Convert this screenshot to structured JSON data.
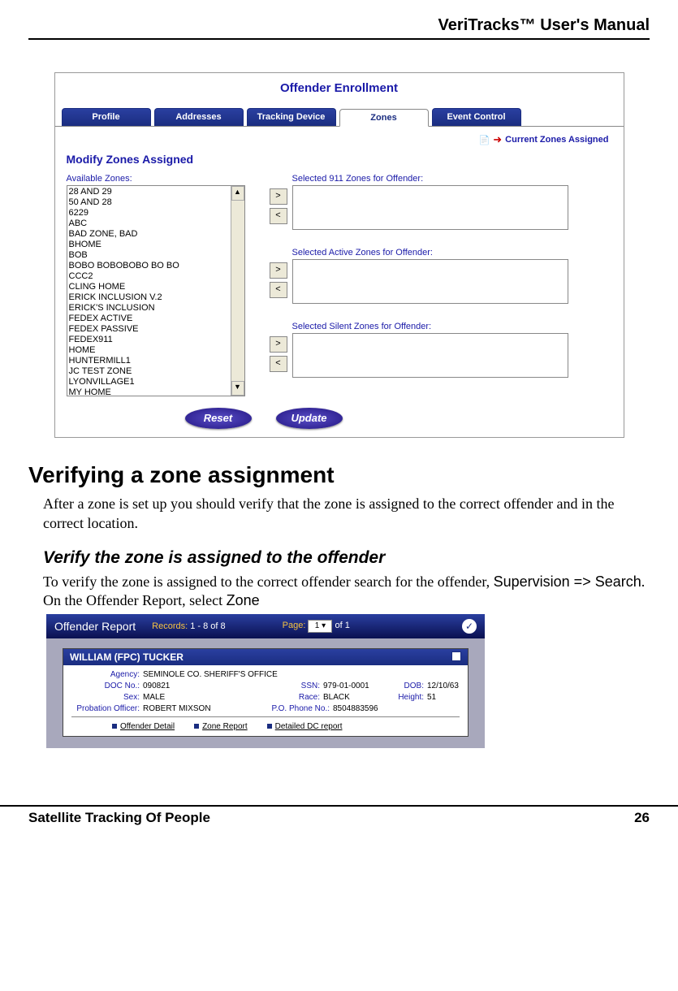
{
  "header": {
    "title": "VeriTracks™ User's Manual"
  },
  "screenshot1": {
    "title": "Offender Enrollment",
    "tabs": [
      "Profile",
      "Addresses",
      "Tracking Device",
      "Zones",
      "Event Control"
    ],
    "current_link": "Current Zones Assigned",
    "section_title": "Modify Zones Assigned",
    "available_label": "Available Zones:",
    "available_items": [
      "28 AND 29",
      "50 AND 28",
      "6229",
      "ABC",
      "BAD ZONE, BAD",
      "BHOME",
      "BOB",
      "BOBO BOBOBOBO BO BO",
      "CCC2",
      "CLING HOME",
      "ERICK INCLUSION V.2",
      "ERICK'S INCLUSION",
      "FEDEX ACTIVE",
      "FEDEX PASSIVE",
      "FEDEX911",
      "HOME",
      "HUNTERMILL1",
      "JC TEST ZONE",
      "LYONVILLAGE1",
      "MY HOME"
    ],
    "sel_911": "Selected 911 Zones for Offender:",
    "sel_active": "Selected Active Zones for Offender:",
    "sel_silent": "Selected Silent Zones for Offender:",
    "btn_reset": "Reset",
    "btn_update": "Update"
  },
  "body": {
    "h1": "Verifying a zone assignment",
    "p1": "After a zone is set up you should verify that the zone is assigned to the correct offender and in the correct location.",
    "h2": "Verify the zone is assigned to the offender",
    "p2a": "To verify the zone is assigned to the correct offender search for the offender, ",
    "p2b": "Supervision => Search",
    "p2c": ".  On the Offender Report, select ",
    "p2d": "Zone"
  },
  "screenshot2": {
    "title": "Offender Report",
    "records_label": "Records:",
    "records_value": "1 - 8  of  8",
    "page_label": "Page:",
    "page_value": "1",
    "page_of": "of  1",
    "name": "WILLIAM (FPC) TUCKER",
    "rows": {
      "agency_lbl": "Agency:",
      "agency": "SEMINOLE CO. SHERIFF'S OFFICE",
      "doc_lbl": "DOC No.:",
      "doc": "090821",
      "ssn_lbl": "SSN:",
      "ssn": "979-01-0001",
      "dob_lbl": "DOB:",
      "dob": "12/10/63",
      "sex_lbl": "Sex:",
      "sex": "MALE",
      "race_lbl": "Race:",
      "race": "BLACK",
      "height_lbl": "Height:",
      "height": "51",
      "po_lbl": "Probation Officer:",
      "po": "ROBERT MIXSON",
      "phone_lbl": "P.O. Phone No.:",
      "phone": "8504883596"
    },
    "links": [
      "Offender Detail",
      "Zone Report",
      "Detailed DC report"
    ]
  },
  "footer": {
    "left": "Satellite Tracking Of People",
    "right": "26"
  }
}
